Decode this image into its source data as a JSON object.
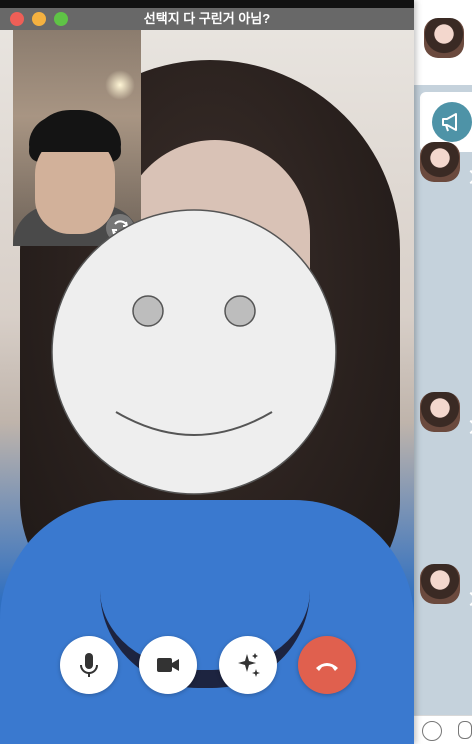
{
  "window": {
    "title": "선택지 다 구린거 아님?"
  },
  "colors": {
    "close": "#ee5f57",
    "minimize": "#f4b140",
    "maximize": "#5fc346",
    "end_call": "#e0604e",
    "notice_icon_bg": "#4e93a7"
  },
  "icons": {
    "mute": "microphone-icon",
    "video": "video-camera-icon",
    "effects": "sparkles-icon",
    "end_call": "phone-hangup-icon",
    "switch_camera": "rotate-camera-icon",
    "notice": "megaphone-icon",
    "emoji": "smile-icon",
    "attach": "paperclip-icon"
  }
}
